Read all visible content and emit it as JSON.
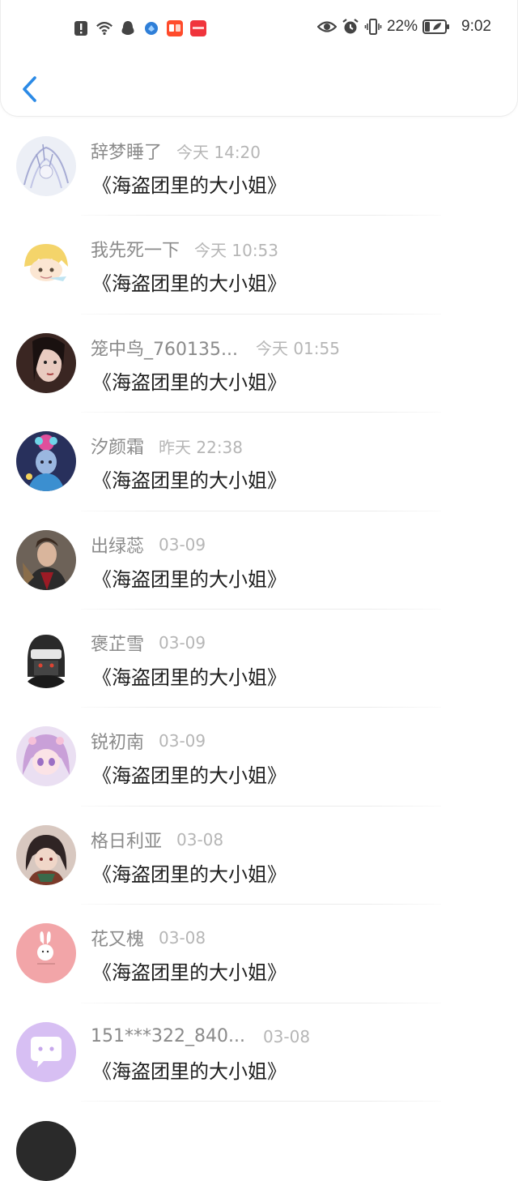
{
  "status_bar": {
    "battery_percent": "22%",
    "time": "9:02"
  },
  "header": {
    "back_icon": "chevron-left-icon",
    "accent_color": "#2b8ae6"
  },
  "list": [
    {
      "name": "辞梦睡了",
      "time": "今天 14:20",
      "title": "《海盗团里的大小姐》",
      "avatar": "anime-sketch"
    },
    {
      "name": "我先死一下",
      "time": "今天 10:53",
      "title": "《海盗团里的大小姐》",
      "avatar": "blonde-chibi"
    },
    {
      "name": "笼中鸟_760135...",
      "time": "今天 01:55",
      "title": "《海盗团里的大小姐》",
      "avatar": "dark-hair-girl"
    },
    {
      "name": "汐颜霜",
      "time": "昨天 22:38",
      "title": "《海盗团里的大小姐》",
      "avatar": "blue-flower-girl"
    },
    {
      "name": "出绿蕊",
      "time": "03-09",
      "title": "《海盗团里的大小姐》",
      "avatar": "man-red-shirt"
    },
    {
      "name": "褒芷雪",
      "time": "03-09",
      "title": "《海盗团里的大小姐》",
      "avatar": "helmet-mask"
    },
    {
      "name": "锐初南",
      "time": "03-09",
      "title": "《海盗团里的大小姐》",
      "avatar": "pink-anime-girl"
    },
    {
      "name": "格日利亚",
      "time": "03-08",
      "title": "《海盗团里的大小姐》",
      "avatar": "dark-anime-girl"
    },
    {
      "name": "花又槐",
      "time": "03-08",
      "title": "《海盗团里的大小姐》",
      "avatar": "pink-bunny"
    },
    {
      "name": "151***322_840...",
      "time": "03-08",
      "title": "《海盗团里的大小姐》",
      "avatar": "purple-chat-bubble"
    }
  ]
}
